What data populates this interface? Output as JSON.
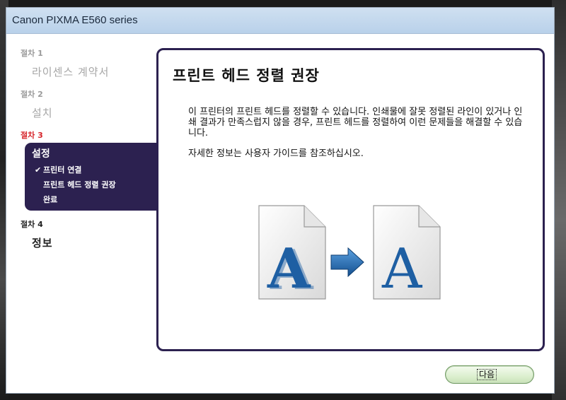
{
  "window": {
    "title": "Canon PIXMA E560 series"
  },
  "steps": [
    {
      "label": "절차 1",
      "name": "라이센스 계약서"
    },
    {
      "label": "절차 2",
      "name": "설치"
    },
    {
      "label": "절차 3",
      "name": "설정",
      "subitems": [
        {
          "text": "프린터 연결",
          "checked": true
        },
        {
          "text": "프린트 헤드 정렬 권장",
          "checked": false
        },
        {
          "text": "완료",
          "checked": false
        }
      ]
    },
    {
      "label": "절차 4",
      "name": "정보"
    }
  ],
  "content": {
    "heading": "프린트 헤드 정렬 권장",
    "paragraph1": "이 프린터의 프린트 헤드를 정렬할 수 있습니다. 인쇄물에 잘못 정렬된 라인이 있거나 인쇄 결과가 만족스럽지 않을 경우, 프린트 헤드를 정렬하여 이런 문제들을 해결할 수 있습니다.",
    "paragraph2": "자세한 정보는 사용자 가이드를 참조하십시오.",
    "illustration": {
      "before_glyph": "A",
      "after_glyph": "A",
      "before_icon": "misaligned-document-icon",
      "arrow_icon": "arrow-right-icon",
      "after_icon": "aligned-document-icon"
    }
  },
  "footer": {
    "next_label": "다음"
  },
  "colors": {
    "accent": "#2c2150",
    "active_step": "#d6242a",
    "titlebar": "#b9d1ea",
    "glyph_blue": "#1e5fa3"
  }
}
